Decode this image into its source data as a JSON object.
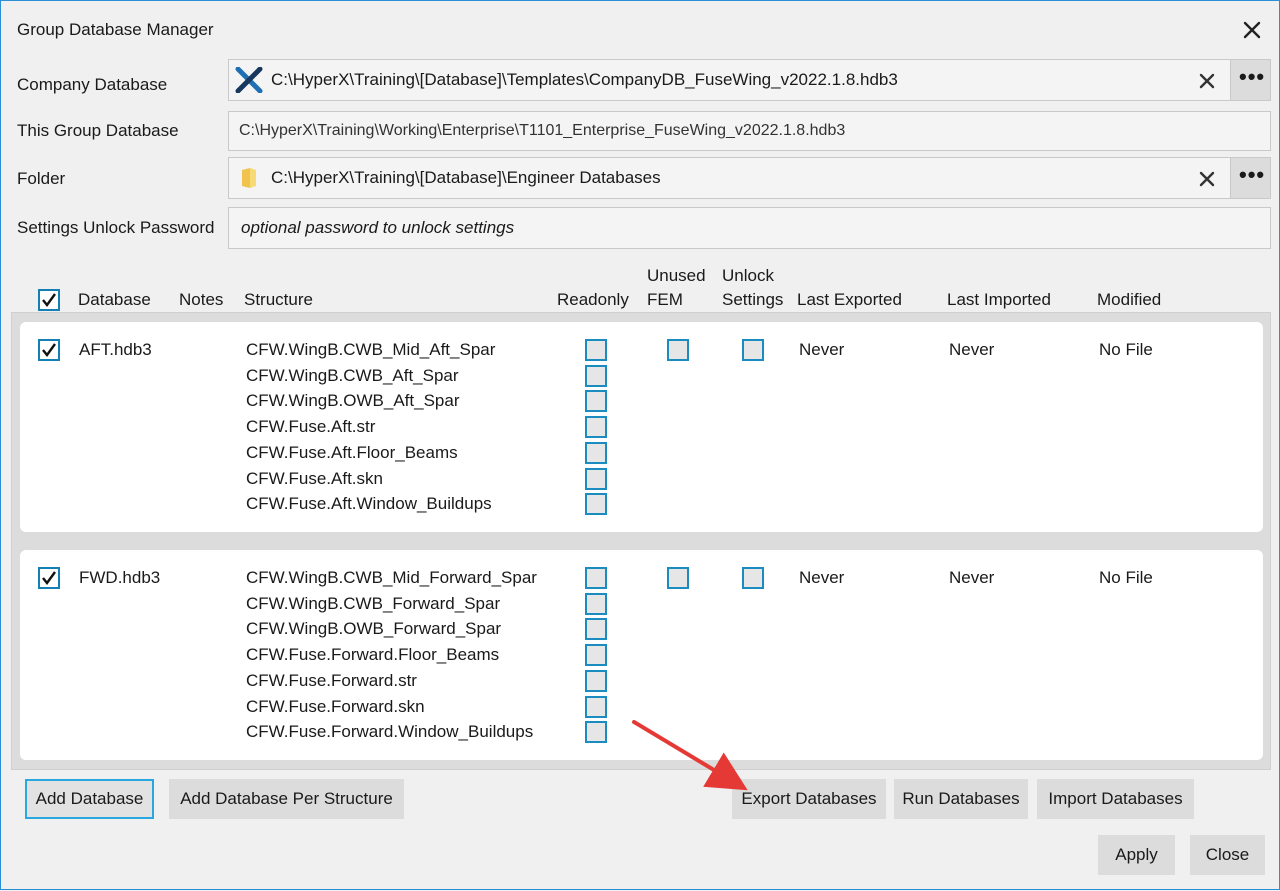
{
  "window": {
    "title": "Group Database Manager"
  },
  "form": {
    "company_db": {
      "label": "Company Database",
      "value": "C:\\HyperX\\Training\\[Database]\\Templates\\CompanyDB_FuseWing_v2022.1.8.hdb3",
      "icon": "hyperx-x-icon"
    },
    "group_db": {
      "label": "This Group Database",
      "value": "C:\\HyperX\\Training\\Working\\Enterprise\\T1101_Enterprise_FuseWing_v2022.1.8.hdb3"
    },
    "folder": {
      "label": "Folder",
      "value": "C:\\HyperX\\Training\\[Database]\\Engineer Databases",
      "icon": "folder-icon"
    },
    "password": {
      "label": "Settings Unlock Password",
      "placeholder": "optional password to unlock settings",
      "value": ""
    },
    "more_label": "•••"
  },
  "columns": {
    "database": "Database",
    "notes": "Notes",
    "structure": "Structure",
    "readonly": "Readonly",
    "unused_fem_1": "Unused",
    "unused_fem_2": "FEM",
    "unlock_settings_1": "Unlock",
    "unlock_settings_2": "Settings",
    "last_exported": "Last Exported",
    "last_imported": "Last Imported",
    "modified": "Modified"
  },
  "select_all_checked": true,
  "databases": [
    {
      "name": "AFT.hdb3",
      "checked": true,
      "structures": [
        "CFW.WingB.CWB_Mid_Aft_Spar",
        "CFW.WingB.CWB_Aft_Spar",
        "CFW.WingB.OWB_Aft_Spar",
        "CFW.Fuse.Aft.str",
        "CFW.Fuse.Aft.Floor_Beams",
        "CFW.Fuse.Aft.skn",
        "CFW.Fuse.Aft.Window_Buildups"
      ],
      "last_exported": "Never",
      "last_imported": "Never",
      "modified": "No File"
    },
    {
      "name": "FWD.hdb3",
      "checked": true,
      "structures": [
        "CFW.WingB.CWB_Mid_Forward_Spar",
        "CFW.WingB.CWB_Forward_Spar",
        "CFW.WingB.OWB_Forward_Spar",
        "CFW.Fuse.Forward.Floor_Beams",
        "CFW.Fuse.Forward.str",
        "CFW.Fuse.Forward.skn",
        "CFW.Fuse.Forward.Window_Buildups"
      ],
      "last_exported": "Never",
      "last_imported": "Never",
      "modified": "No File"
    }
  ],
  "buttons": {
    "add_database": "Add Database",
    "add_per_structure": "Add Database Per Structure",
    "export": "Export Databases",
    "run": "Run Databases",
    "import": "Import Databases",
    "apply": "Apply",
    "close": "Close"
  },
  "colors": {
    "accent": "#1b8cc0",
    "annotation_arrow": "#e53935",
    "focus_border": "#29a7e0"
  }
}
